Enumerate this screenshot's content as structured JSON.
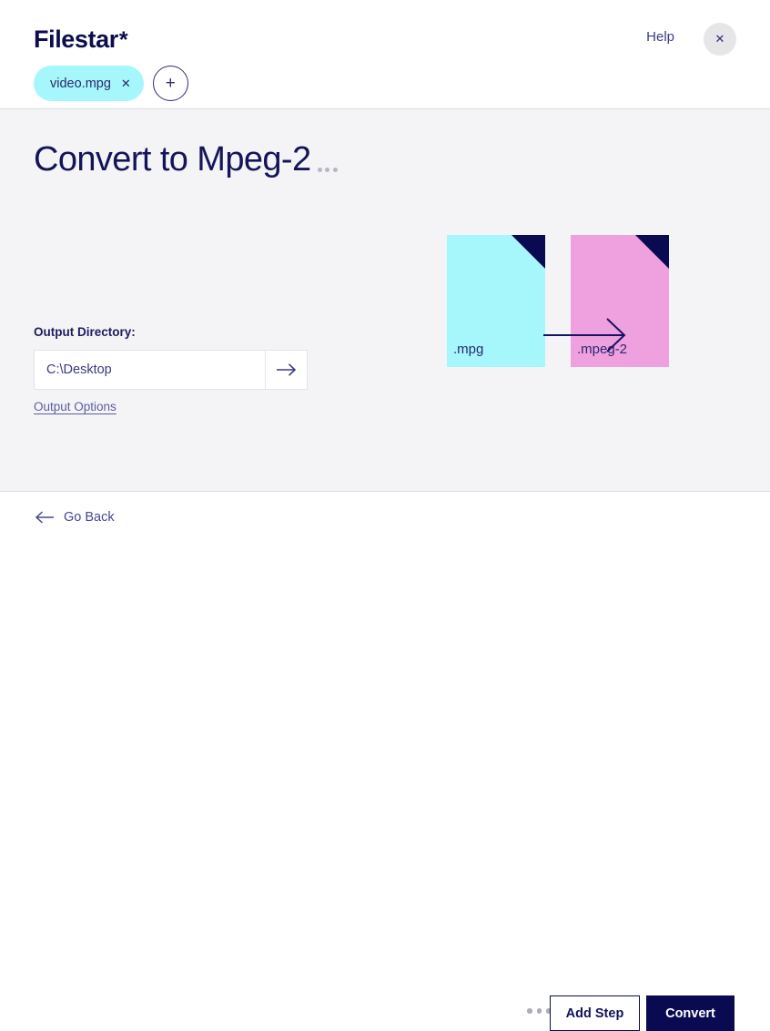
{
  "header": {
    "brand_name": "Filestar",
    "brand_star": "*",
    "help_label": "Help",
    "close_icon": "close-icon",
    "close_glyph": "✕",
    "files": [
      {
        "name": "video.mpg",
        "close_glyph": "✕"
      }
    ],
    "add_file_glyph": "+"
  },
  "main": {
    "page_title": "Convert to Mpeg-2",
    "title_more_icon": "ellipsis-icon",
    "output_directory_label": "Output Directory:",
    "output_directory_value": "C:\\Desktop",
    "output_directory_placeholder": "C:\\Desktop",
    "output_directory_go_icon": "arrow-right-icon",
    "output_options_label": "Output Options"
  },
  "illustration": {
    "source": {
      "extension_label": ".mpg",
      "color": "#a6f7fb",
      "fold_color": "#0a0a52"
    },
    "target": {
      "extension_label": ".mpeg-2",
      "color": "#efa0de",
      "fold_color": "#0a0a52"
    },
    "arrow_icon": "arrow-right-icon"
  },
  "footer": {
    "go_back_label": "Go Back",
    "go_back_icon": "arrow-left-icon",
    "more_icon": "ellipsis-icon",
    "add_step_label": "Add Step",
    "convert_label": "Convert"
  },
  "colors": {
    "brand_navy": "#0a0a52",
    "accent_cyan": "#a6f7fb",
    "accent_pink": "#efa0de",
    "body_background": "#f4f4f7",
    "link_purple": "#5c5ca0"
  }
}
